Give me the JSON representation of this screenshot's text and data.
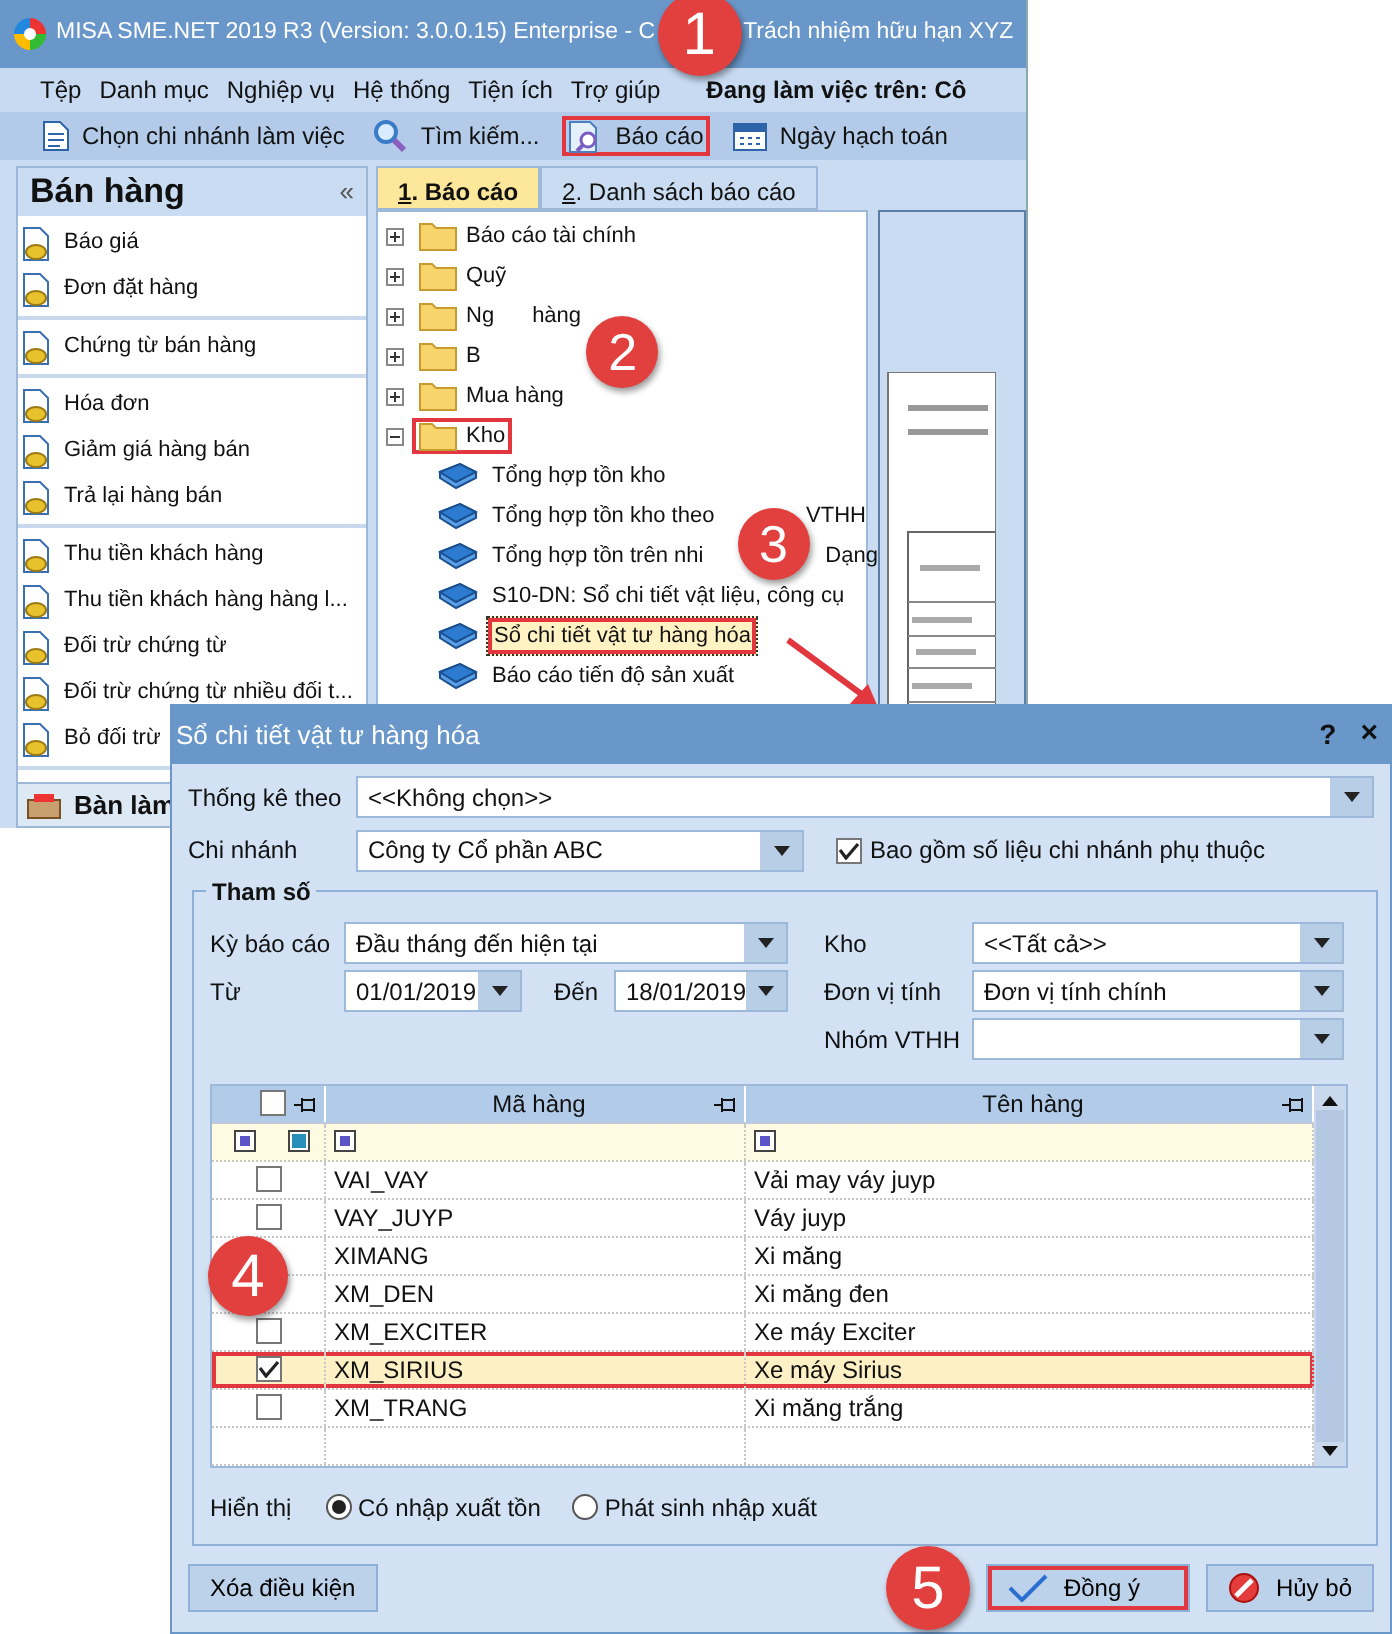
{
  "app": {
    "title_start": "MISA SME.NET 2019 R3 (Version: 3.0.0.15) Enterprise - C",
    "title_end": "Trách nhiệm hữu hạn XYZ",
    "menu": [
      "Tệp",
      "Danh mục",
      "Nghiệp vụ",
      "Hệ thống",
      "Tiện ích",
      "Trợ giúp"
    ],
    "working_on": "Đang làm việc trên: Cô",
    "toolbar": [
      {
        "label": "Chọn chi nhánh làm việc",
        "highlighted": false
      },
      {
        "label": "Tìm kiếm...",
        "highlighted": false
      },
      {
        "label": "Báo cáo",
        "highlighted": true
      },
      {
        "label": "Ngày hạch toán",
        "highlighted": false
      }
    ],
    "sidebar": {
      "title": "Bán hàng",
      "collapse": "«",
      "groups": [
        [
          "Báo giá",
          "Đơn đặt hàng"
        ],
        [
          "Chứng từ bán hàng"
        ],
        [
          "Hóa đơn",
          "Giảm giá hàng bán",
          "Trả lại hàng bán"
        ],
        [
          "Thu tiền khách hàng",
          "Thu tiền khách hàng hàng l...",
          "Đối trừ chứng từ",
          "Đối trừ chứng từ nhiều đối t...",
          "Bỏ đối trừ"
        ]
      ],
      "bottom": "Bàn làm"
    },
    "tabs": [
      {
        "label": "1. Báo cáo",
        "selected": true
      },
      {
        "label": "2. Danh sách báo cáo",
        "selected": false
      }
    ],
    "tree": [
      {
        "label": "Báo cáo tài chính",
        "expanded": false,
        "highlighted": false
      },
      {
        "label": "Quỹ",
        "expanded": false,
        "highlighted": false
      },
      {
        "label": "Ng",
        "label_end": "hàng",
        "expanded": false,
        "highlighted": false
      },
      {
        "label": "B",
        "expanded": false,
        "highlighted": false
      },
      {
        "label": "Mua hàng",
        "expanded": false,
        "highlighted": false
      },
      {
        "label": "Kho",
        "expanded": true,
        "highlighted": true,
        "children": [
          {
            "label": "Tổng hợp tồn kho",
            "selected": false,
            "highlighted": false
          },
          {
            "label": "Tổng hợp tồn kho theo",
            "label_end": "VTHH",
            "selected": false,
            "highlighted": false
          },
          {
            "label": "Tổng hợp tồn trên nhi",
            "label_end": "Dạng",
            "selected": false,
            "highlighted": false
          },
          {
            "label": "S10-DN: Sổ chi tiết vật liệu, công cụ",
            "selected": false,
            "highlighted": false
          },
          {
            "label": "Sổ chi tiết vật tư hàng hóa",
            "selected": true,
            "highlighted": true
          },
          {
            "label": "Báo cáo tiến độ sản xuất",
            "selected": false,
            "highlighted": false
          }
        ]
      }
    ]
  },
  "callouts": [
    "1",
    "2",
    "3",
    "4",
    "5"
  ],
  "dialog": {
    "title": "Sổ chi tiết vật tư hàng hóa",
    "help": "?",
    "close": "×",
    "stat_by": {
      "label": "Thống kê theo",
      "value": "<<Không chọn>>"
    },
    "branch": {
      "label": "Chi nhánh",
      "value": "Công ty Cổ phần ABC"
    },
    "include_dependent": {
      "label": "Bao gồm số liệu chi nhánh phụ thuộc",
      "checked": true
    },
    "params": {
      "legend": "Tham số",
      "period": {
        "label": "Kỳ báo cáo",
        "value": "Đầu tháng đến hiện tại"
      },
      "from": {
        "label": "Từ",
        "value": "01/01/2019"
      },
      "to": {
        "label": "Đến",
        "value": "18/01/2019"
      },
      "warehouse": {
        "label": "Kho",
        "value": "<<Tất cả>>"
      },
      "unit": {
        "label": "Đơn vị tính",
        "value": "Đơn vị tính chính"
      },
      "group": {
        "label": "Nhóm VTHH"
      },
      "grid": {
        "columns": [
          "Mã hàng",
          "Tên hàng"
        ],
        "all_checked": false,
        "rows": [
          {
            "code": "VAI_VAY",
            "name": "Vải may váy juyp",
            "checked": false,
            "selected": false,
            "highlighted": false
          },
          {
            "code": "VAY_JUYP",
            "name": "Váy juyp",
            "checked": false,
            "selected": false,
            "highlighted": false
          },
          {
            "code": "XIMANG",
            "name": "Xi măng",
            "selected": false,
            "highlighted": false
          },
          {
            "code": "XM_DEN",
            "name": "Xi măng đen",
            "selected": false,
            "highlighted": false
          },
          {
            "code": "XM_EXCITER",
            "name": "Xe máy Exciter",
            "checked": false,
            "selected": false,
            "highlighted": false
          },
          {
            "code": "XM_SIRIUS",
            "name": "Xe máy Sirius",
            "checked": true,
            "selected": true,
            "highlighted": true
          },
          {
            "code": "XM_TRANG",
            "name": "Xi măng trắng",
            "checked": false,
            "selected": false,
            "highlighted": false
          }
        ]
      },
      "display": {
        "label": "Hiển thị",
        "options": [
          {
            "label": "Có nhập xuất tồn",
            "selected": true
          },
          {
            "label": "Phát sinh nhập xuất",
            "selected": false
          }
        ]
      }
    },
    "buttons": [
      {
        "label": "Xóa điều kiện",
        "kind": "plain",
        "highlighted": false
      },
      {
        "label": "Đồng ý",
        "kind": "ok",
        "highlighted": true
      },
      {
        "label": "Hủy bỏ",
        "kind": "cancel",
        "highlighted": false
      }
    ]
  }
}
